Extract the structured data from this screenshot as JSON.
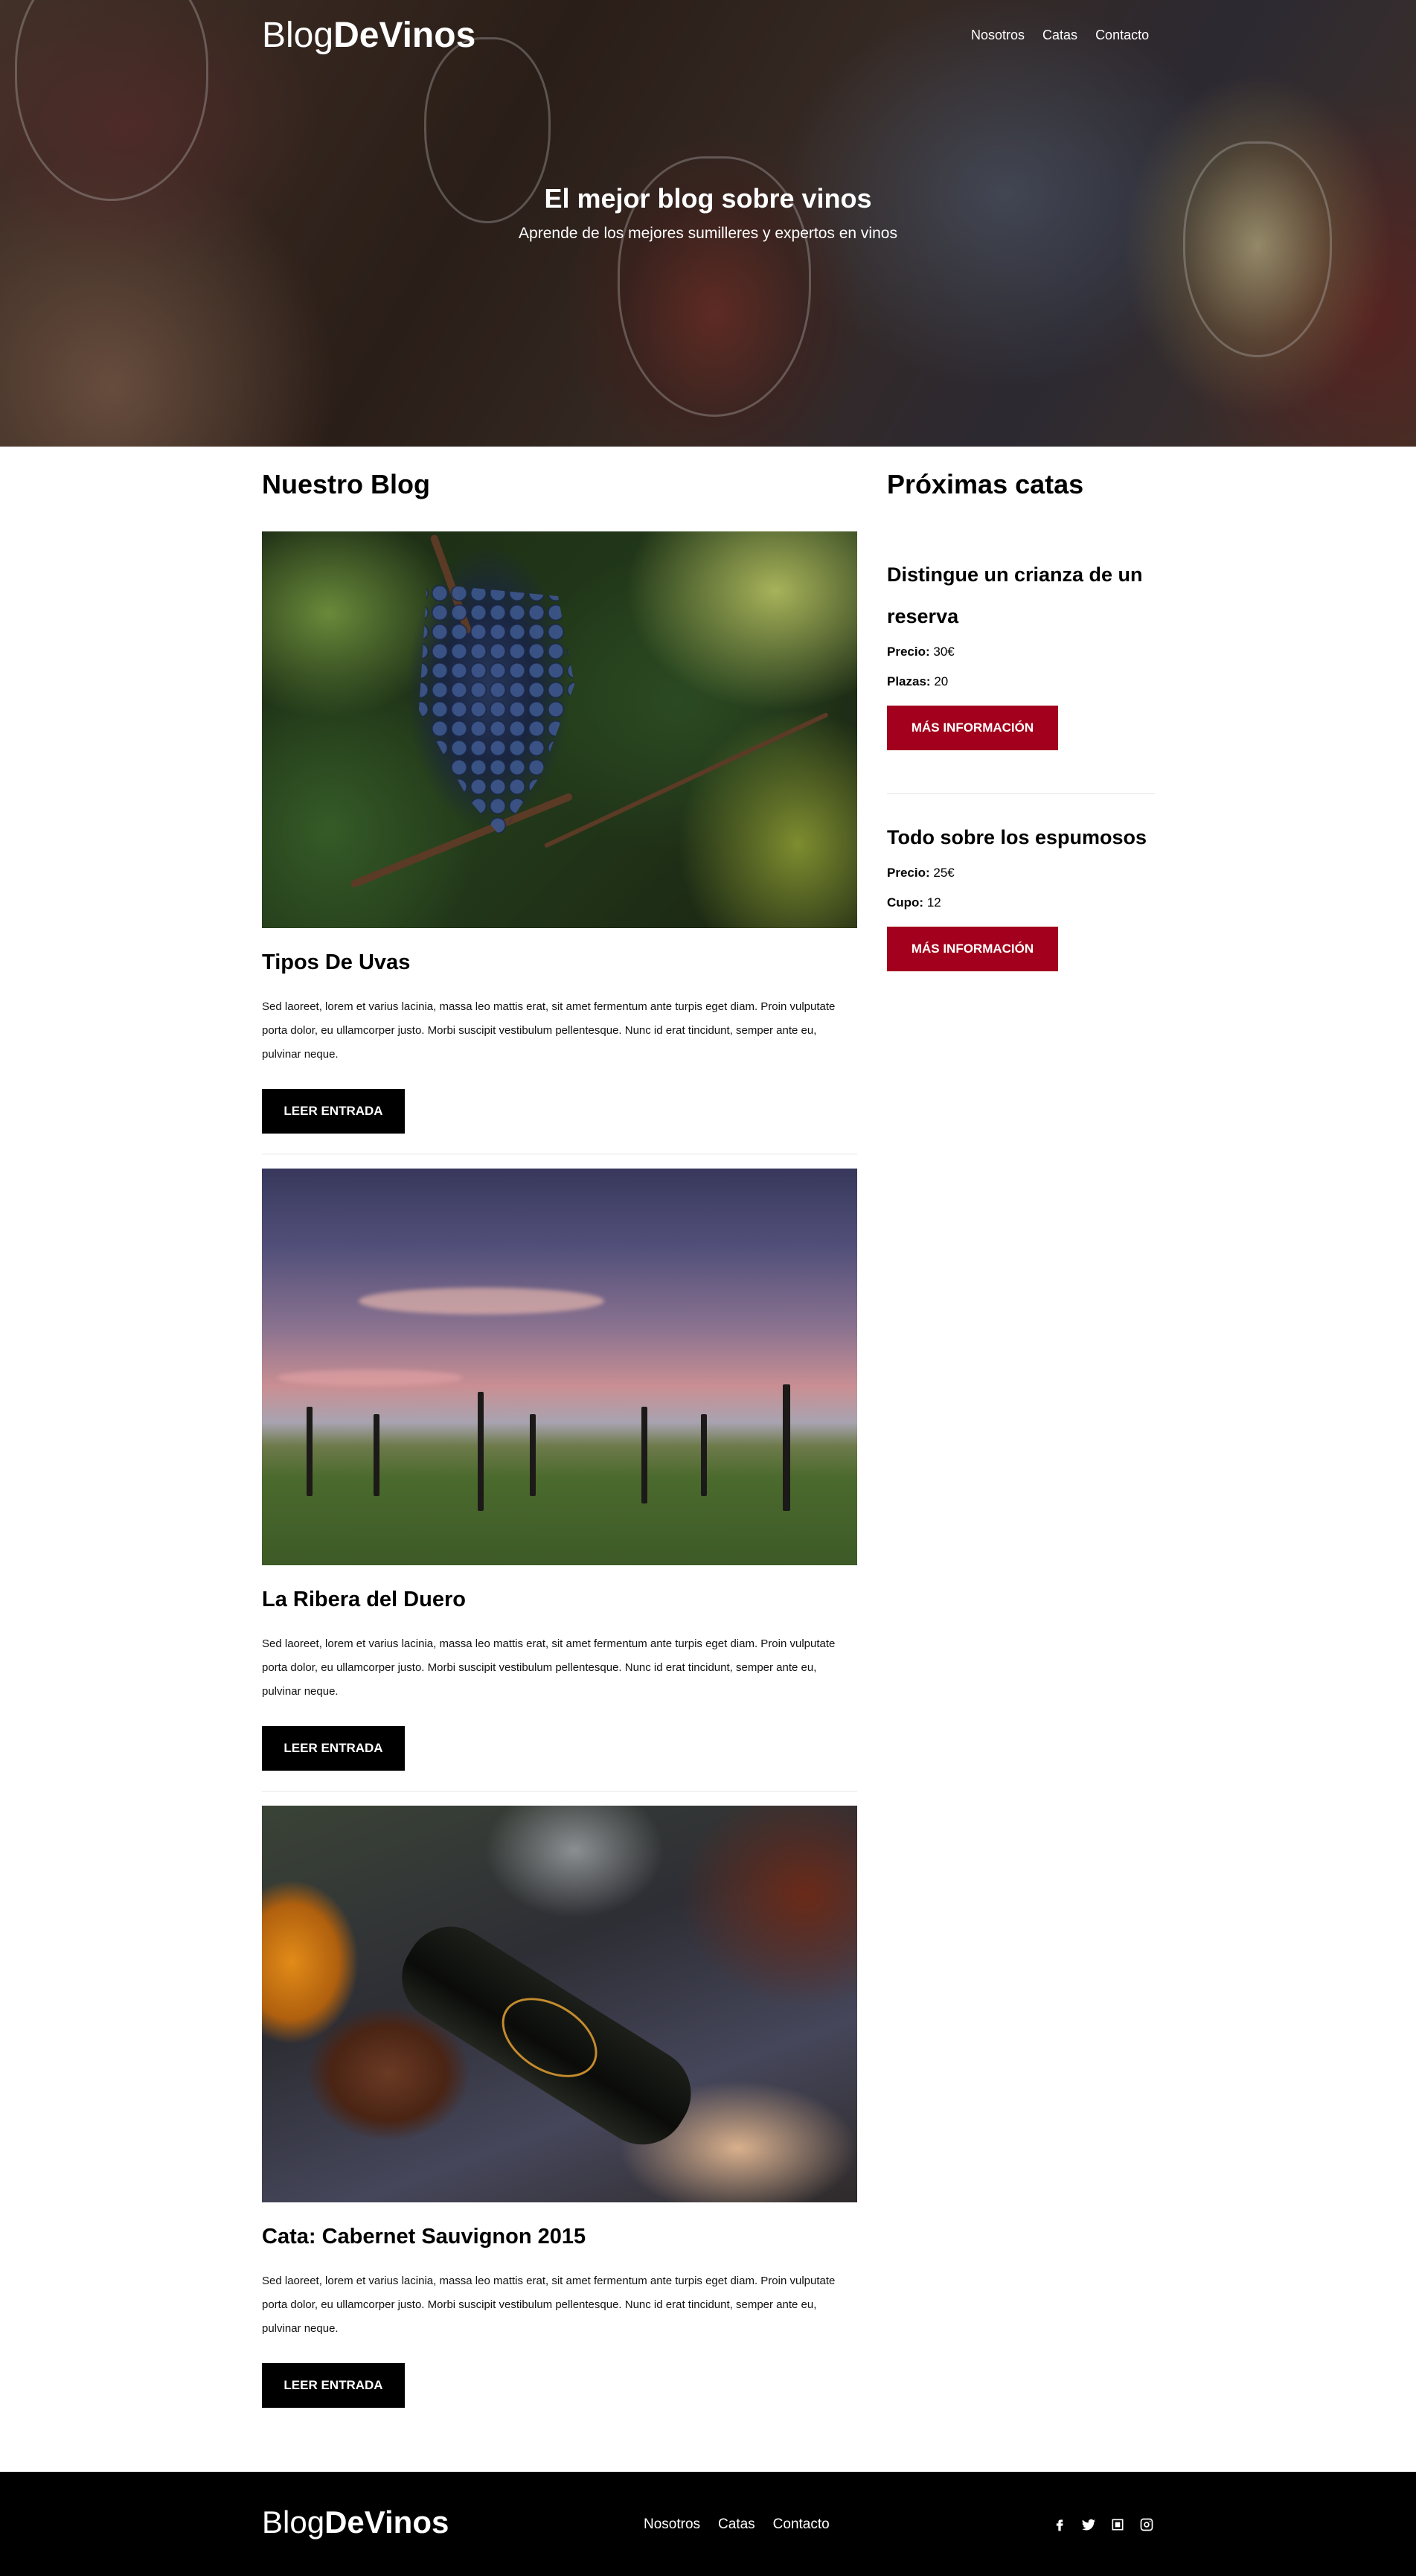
{
  "brand": {
    "light": "Blog",
    "bold": "DeVinos"
  },
  "nav": [
    "Nosotros",
    "Catas",
    "Contacto"
  ],
  "hero": {
    "title": "El mejor blog sobre vinos",
    "subtitle": "Aprende de los mejores sumilleres y expertos en vinos"
  },
  "blog": {
    "heading": "Nuestro Blog",
    "posts": [
      {
        "title": "Tipos De Uvas",
        "text": "Sed laoreet, lorem et varius lacinia, massa leo mattis erat, sit amet fermentum ante turpis eget diam. Proin vulputate porta dolor, eu ullamcorper justo. Morbi suscipit vestibulum pellentesque. Nunc id erat tincidunt, semper ante eu, pulvinar neque.",
        "button": "Leer Entrada",
        "image": "grapes-on-vine"
      },
      {
        "title": "La Ribera del Duero",
        "text": "Sed laoreet, lorem et varius lacinia, massa leo mattis erat, sit amet fermentum ante turpis eget diam. Proin vulputate porta dolor, eu ullamcorper justo. Morbi suscipit vestibulum pellentesque. Nunc id erat tincidunt, semper ante eu, pulvinar neque.",
        "button": "Leer Entrada",
        "image": "vineyard-sunset"
      },
      {
        "title": "Cata: Cabernet Sauvignon 2015",
        "text": "Sed laoreet, lorem et varius lacinia, massa leo mattis erat, sit amet fermentum ante turpis eget diam. Proin vulputate porta dolor, eu ullamcorper justo. Morbi suscipit vestibulum pellentesque. Nunc id erat tincidunt, semper ante eu, pulvinar neque.",
        "button": "Leer Entrada",
        "image": "wine-bottle-still-life"
      }
    ]
  },
  "catas": {
    "heading": "Próximas catas",
    "events": [
      {
        "title": "Distingue un crianza de un reserva",
        "row1_label": "Precio:",
        "row1_value": "30€",
        "row2_label": "Plazas:",
        "row2_value": "20",
        "button": "Más Información"
      },
      {
        "title": "Todo sobre los espumosos",
        "row1_label": "Precio:",
        "row1_value": "25€",
        "row2_label": "Cupo:",
        "row2_value": "12",
        "button": "Más Información"
      }
    ]
  },
  "footer": {
    "social_icons": [
      "facebook-icon",
      "twitter-icon",
      "youtube-icon",
      "instagram-icon"
    ]
  },
  "colors": {
    "accent": "#a2001c",
    "dark": "#000000",
    "text": "#111111"
  }
}
